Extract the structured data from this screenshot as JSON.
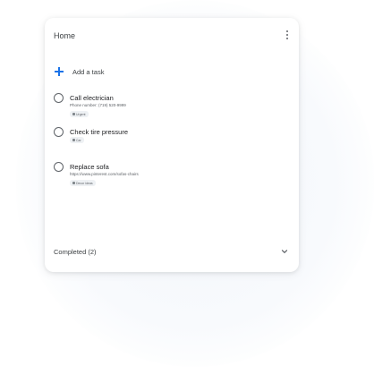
{
  "header": {
    "title": "Home"
  },
  "add_task": {
    "label": "Add a task"
  },
  "tasks": [
    {
      "title": "Call electrician",
      "detail": "Phone number: (719) 520-9999",
      "chip": "Urgent"
    },
    {
      "title": "Check tire pressure",
      "detail": "",
      "chip": "Car"
    },
    {
      "title": "Replace sofa",
      "detail": "https://www.pinterest.com/sofas-chairs",
      "chip": "Decor ideas"
    }
  ],
  "completed": {
    "label": "Completed (2)"
  },
  "colors": {
    "accent": "#1a73e8",
    "icon_gray": "#5f6368",
    "text": "#202124"
  },
  "icons": [
    "menu-dots-icon",
    "plus-icon",
    "circle-icon",
    "chevron-down-icon"
  ]
}
